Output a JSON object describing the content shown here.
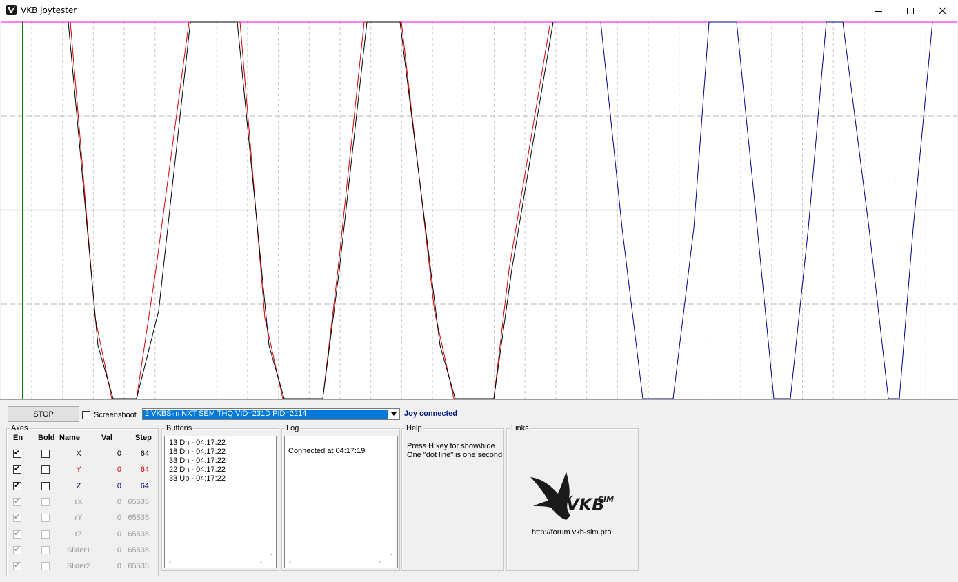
{
  "window": {
    "title": "VKB joytester",
    "controls": [
      "minimize",
      "maximize",
      "close"
    ]
  },
  "colors": {
    "x_axis": "#000000",
    "y_axis": "#d40000",
    "z_axis": "#00007f",
    "top_line": "#ff00ff",
    "cursor_line": "#007f00",
    "selection": "#0078d7",
    "status_text": "#001a80"
  },
  "toolbar": {
    "stop_label": "STOP",
    "screenshoot_label": "Screenshoot",
    "screenshoot_checked": false,
    "device_selected": "2  VKBSim NXT SEM THQ  VID=231D PID=2214",
    "joy_status": "Joy connected"
  },
  "axes": {
    "title": "Axes",
    "headers": {
      "en": "En",
      "bold": "Bold",
      "name": "Name",
      "val": "Val",
      "step": "Step"
    },
    "rows": [
      {
        "name": "X",
        "val": "0",
        "step": "64",
        "enabled": true,
        "active": true,
        "color": "#000000"
      },
      {
        "name": "Y",
        "val": "0",
        "step": "64",
        "enabled": true,
        "active": true,
        "color": "#d40000"
      },
      {
        "name": "Z",
        "val": "0",
        "step": "64",
        "enabled": true,
        "active": true,
        "color": "#00007f"
      },
      {
        "name": "rX",
        "val": "0",
        "step": "65535",
        "enabled": true,
        "active": false,
        "color": "#9a9a9a"
      },
      {
        "name": "rY",
        "val": "0",
        "step": "65535",
        "enabled": true,
        "active": false,
        "color": "#9a9a9a"
      },
      {
        "name": "rZ",
        "val": "0",
        "step": "65535",
        "enabled": true,
        "active": false,
        "color": "#9a9a9a"
      },
      {
        "name": "Slider1",
        "val": "0",
        "step": "65535",
        "enabled": true,
        "active": false,
        "color": "#9a9a9a"
      },
      {
        "name": "Slider2",
        "val": "0",
        "step": "65535",
        "enabled": true,
        "active": false,
        "color": "#9a9a9a"
      }
    ]
  },
  "buttons_log": {
    "title": "Buttons",
    "entries": [
      "13 Dn - 04:17:22",
      "18 Dn - 04:17:22",
      "33 Dn - 04:17:22",
      "22 Dn - 04:17:22",
      "33 Up - 04:17:22"
    ]
  },
  "log": {
    "title": "Log",
    "entries": [
      "Connected at 04:17:19"
    ]
  },
  "help": {
    "title": "Help",
    "lines": [
      "Press H key for show\\hide",
      "One \"dot line\" is one second"
    ]
  },
  "links": {
    "title": "Links",
    "url": "http://forum.vkb-sim.pro",
    "logo": {
      "text": "VKB",
      "sup": "SIM",
      "icon": "eagle-logo"
    }
  }
}
